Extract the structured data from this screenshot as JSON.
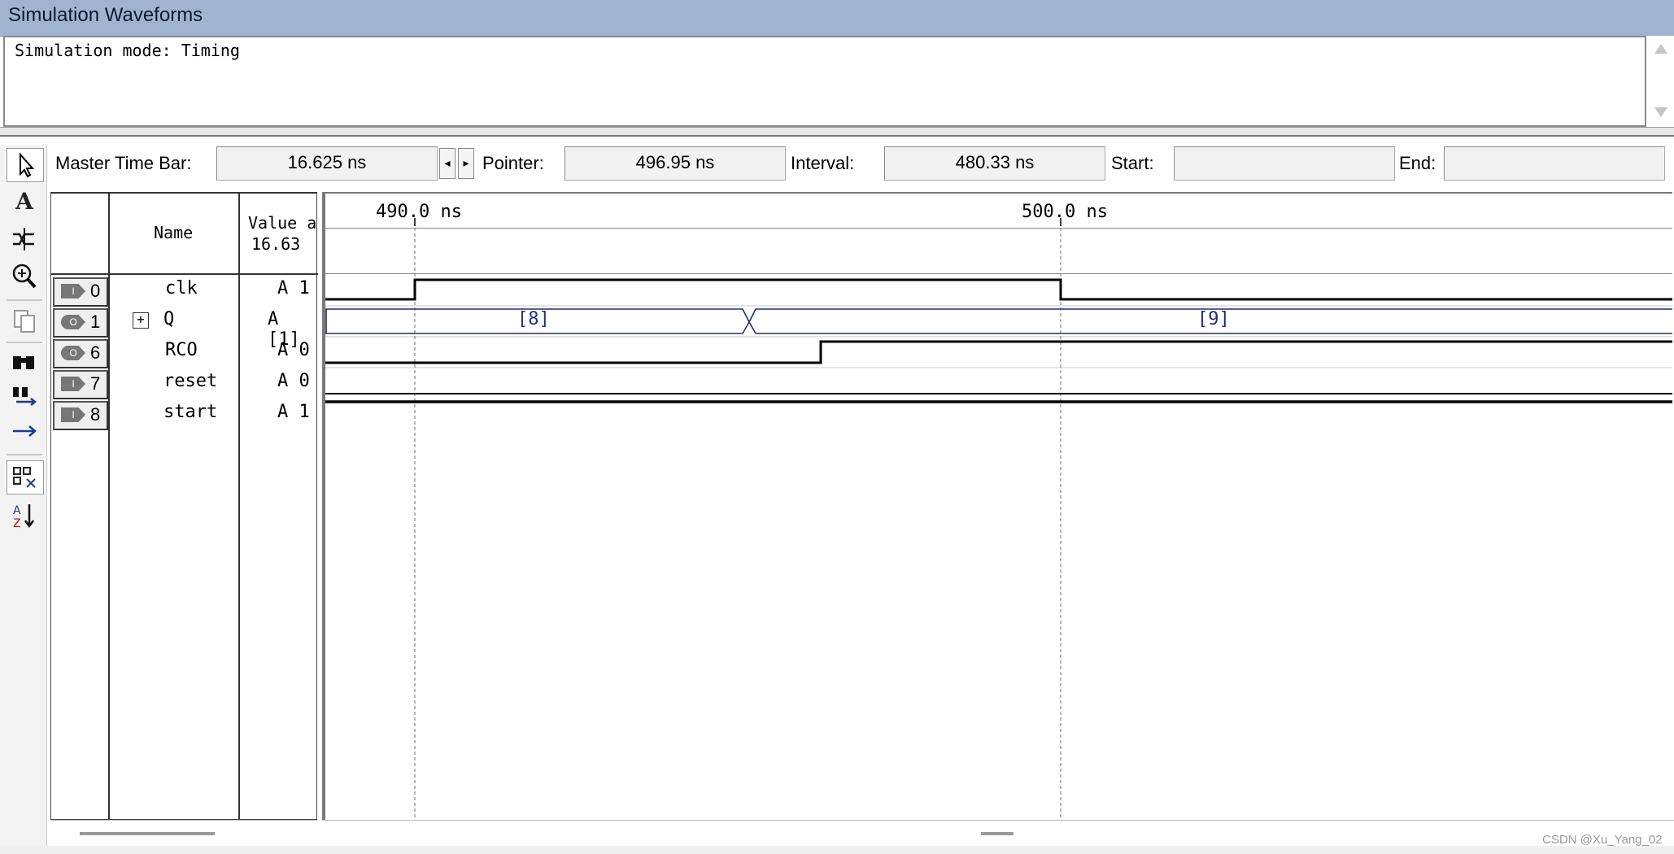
{
  "window": {
    "title": "Simulation Waveforms"
  },
  "messages": {
    "text": "Simulation mode: Timing"
  },
  "timebar": {
    "master_label": "Master Time Bar:",
    "master_value": "16.625 ns",
    "pointer_label": "Pointer:",
    "pointer_value": "496.95 ns",
    "interval_label": "Interval:",
    "interval_value": "480.33 ns",
    "start_label": "Start:",
    "start_value": "",
    "end_label": "End:",
    "end_value": ""
  },
  "toolbar": {
    "icons": [
      "selection-tool-icon",
      "text-tool-icon",
      "waveform-editing-tool-icon",
      "zoom-tool-icon",
      "copy-icon",
      "find-icon",
      "find-next-icon",
      "goto-icon",
      "snap-to-grid-icon",
      "sort-icon"
    ]
  },
  "table": {
    "header_name": "Name",
    "header_value_line1": "Value a",
    "header_value_line2": "16.63"
  },
  "signals": [
    {
      "index": "0",
      "pin": "input",
      "name": "clk",
      "value": "A 1"
    },
    {
      "index": "1",
      "pin": "output",
      "name": "Q",
      "value": "A [1]",
      "expandable": true
    },
    {
      "index": "6",
      "pin": "output",
      "name": "RCO",
      "value": "A 0"
    },
    {
      "index": "7",
      "pin": "input",
      "name": "reset",
      "value": "A 0"
    },
    {
      "index": "8",
      "pin": "input",
      "name": "start",
      "value": "A 1"
    }
  ],
  "ruler": {
    "tick1": "490.0 ns",
    "tick2": "500.0 ns"
  },
  "bus": {
    "q_label1": "[8]",
    "q_label2": "[9]"
  },
  "colors": {
    "titlebar": "#a0b4cf",
    "bus": "#1f2f7a",
    "wave": "#000000"
  },
  "watermark": "CSDN @Xu_Yang_02"
}
